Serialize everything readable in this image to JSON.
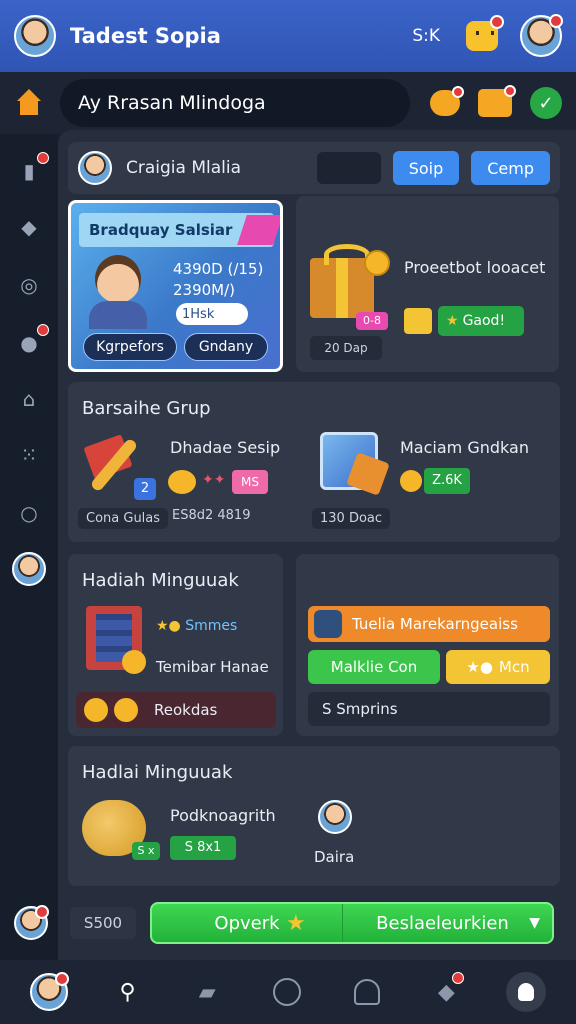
{
  "header": {
    "title": "Tadest Sopia",
    "stat": "S:K",
    "colors": {
      "bar": "#3b63c8",
      "accent": "#f7c22c"
    }
  },
  "search": {
    "placeholder": "Ay Rrasan Mlindoga"
  },
  "profile_bar": {
    "name": "Craigia Mlalia",
    "btn_primary": "Soip",
    "btn_secondary": "Cemp"
  },
  "promo": {
    "banner": "Bradquay Salsiar",
    "value_line1": "4390D (/15)",
    "value_line2": "2390M/)",
    "chip": "1Hsk",
    "btn_left": "Kgrpefors",
    "btn_right": "Gndany"
  },
  "gift": {
    "title": "Proeetbot looacet",
    "chip": "Gaod!",
    "pink_chip": "0-8",
    "day_label": "20 Dap"
  },
  "group": {
    "heading": "Barsaihe Grup",
    "item1_title": "Dhadae Sesip",
    "item1_badge": "2",
    "item1_chip": "MS",
    "item1_foot_left": "Cona Gulas",
    "item1_foot_right": "ES8d2 4819",
    "item2_title": "Maciam Gndkan",
    "item2_chip": "Z.6K",
    "item2_foot": "130 Doac"
  },
  "weekly": {
    "heading": "Hadiah Minguuak",
    "star_line": "Smmes",
    "subtitle": "Temibar Hanae",
    "bar_label": "Reokdas"
  },
  "offers": {
    "orange": "Tuelia Marekarngeaiss",
    "green": "Malklie Con",
    "yellow": "Mcn",
    "dark": "S Smprins"
  },
  "bottom": {
    "heading": "Hadlai Minguuak",
    "title": "Podknoagrith",
    "mini": "S x",
    "chip": "S 8x1",
    "avatar_name": "Daira"
  },
  "action": {
    "count": "S500",
    "cta_left": "Opverk",
    "cta_right": "Beslaeleurkien"
  }
}
